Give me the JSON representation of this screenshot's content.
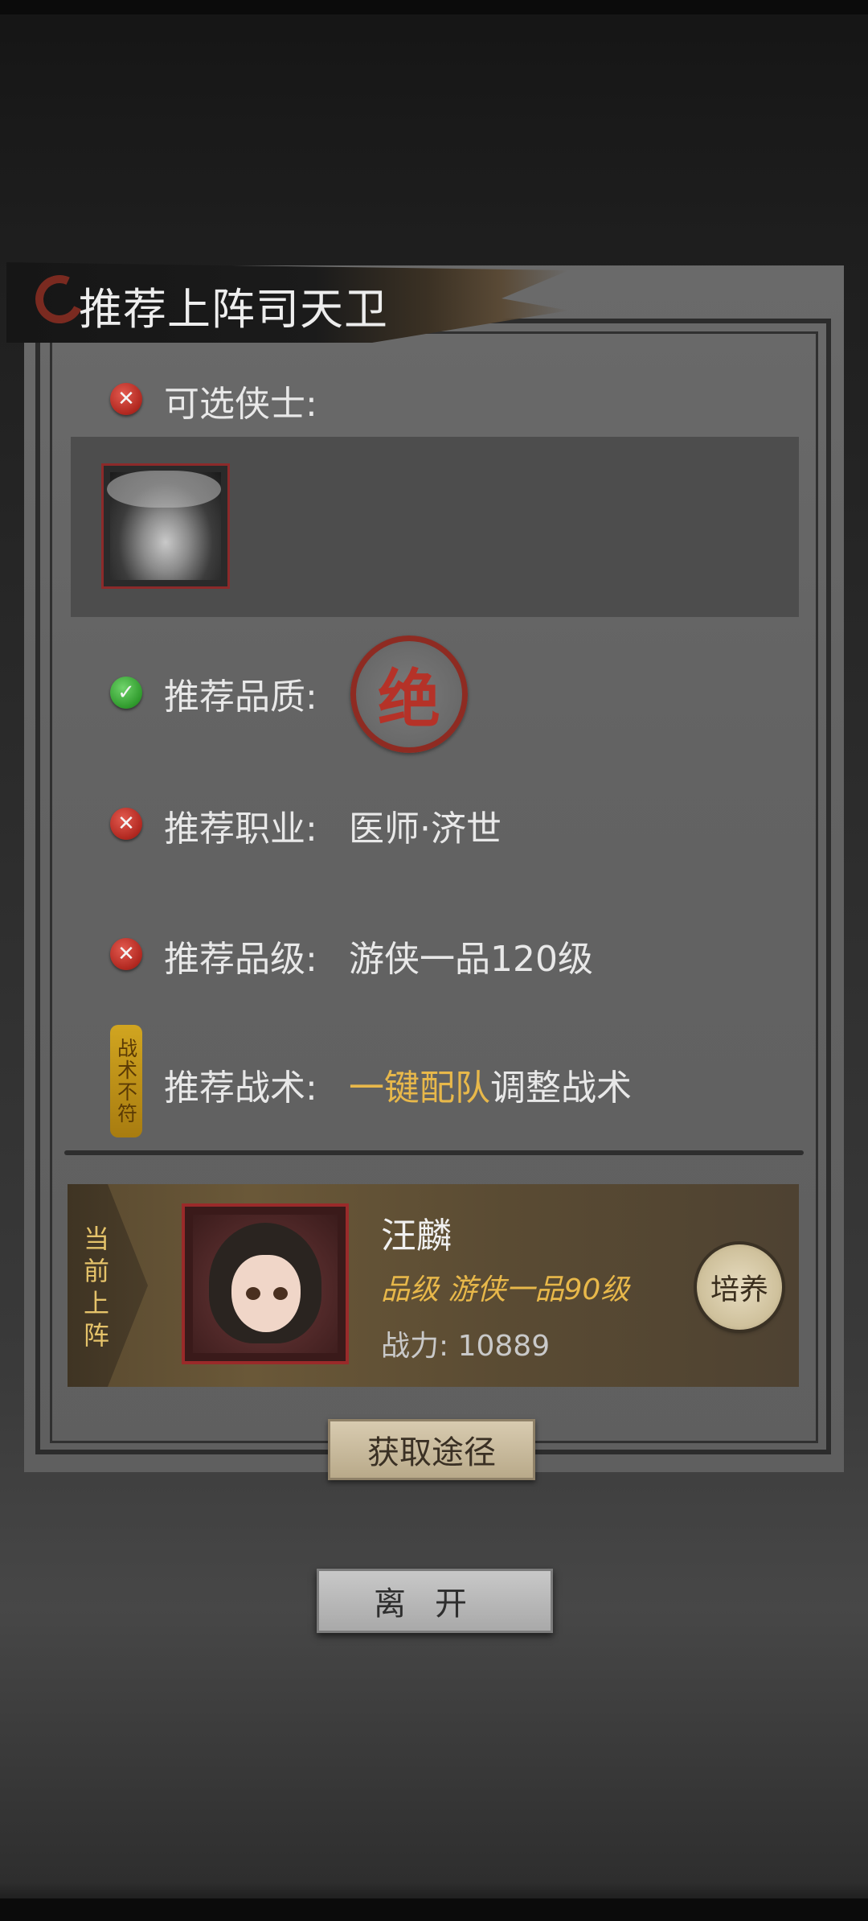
{
  "dialog": {
    "title": "推荐上阵司天卫"
  },
  "requirements": {
    "selectable": {
      "label": "可选侠士:",
      "status": "fail"
    },
    "quality": {
      "label": "推荐品质:",
      "status": "pass",
      "seal_text": "绝"
    },
    "profession": {
      "label": "推荐职业:",
      "value": "医师·济世",
      "status": "fail"
    },
    "grade": {
      "label": "推荐品级:",
      "value": "游侠一品120级",
      "status": "fail"
    },
    "tactic": {
      "badge": "战术不符",
      "label": "推荐战术:",
      "link": "一键配队",
      "suffix": "调整战术"
    }
  },
  "current": {
    "tag": "当前上阵",
    "name": "汪麟",
    "grade": "品级 游侠一品90级",
    "power": "战力: 10889",
    "train_label": "培养"
  },
  "buttons": {
    "source": "获取途径",
    "leave": "离开"
  },
  "colors": {
    "accent_gold": "#e8b84a",
    "fail_red": "#b0271f",
    "pass_green": "#2f9a2c",
    "seal_red": "#b53228"
  }
}
